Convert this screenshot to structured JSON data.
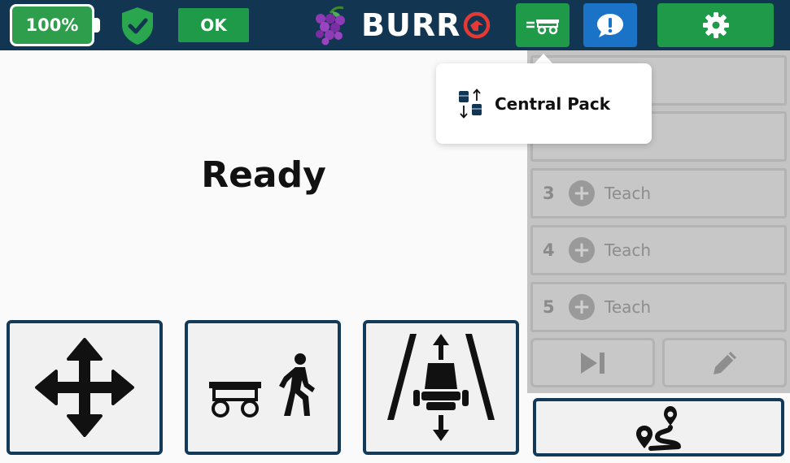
{
  "topbar": {
    "battery_level": "100%",
    "status_badge": "OK",
    "brand": "BURR"
  },
  "main": {
    "status": "Ready"
  },
  "route_panel": {
    "rows": [
      {
        "number": "3",
        "label": "Teach"
      },
      {
        "number": "4",
        "label": "Teach"
      },
      {
        "number": "5",
        "label": "Teach"
      }
    ]
  },
  "popover": {
    "label": "Central Pack"
  },
  "icons": {
    "shield": "shield-check-icon",
    "grapes": "grapes-icon",
    "robot": "robot-cart-icon",
    "message": "message-alert-icon",
    "settings": "gear-icon",
    "move": "move-arrows-icon",
    "follow": "follow-me-icon",
    "height": "height-adjust-icon",
    "skip": "skip-forward-icon",
    "edit": "pencil-icon",
    "route": "route-icon",
    "pack": "central-pack-icon"
  },
  "colors": {
    "topbar": "#123551",
    "green": "#1f9a48",
    "blue": "#1a73c6",
    "tile_border": "#143a5a",
    "panel_dim": "#c4c4c4"
  }
}
